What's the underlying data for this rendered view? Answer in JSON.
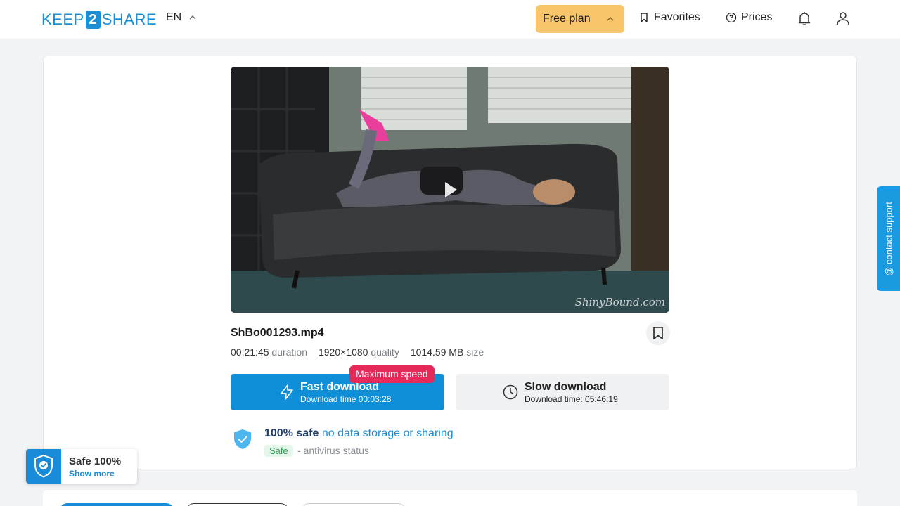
{
  "header": {
    "logo_left": "KEEP",
    "logo_mid": "2",
    "logo_right": "SHARE",
    "language": "EN",
    "plan_label": "Free plan",
    "favorites_label": "Favorites",
    "prices_label": "Prices"
  },
  "file": {
    "name": "ShBo001293.mp4",
    "duration_value": "00:21:45",
    "duration_label": "duration",
    "quality_value": "1920×1080",
    "quality_label": "quality",
    "size_value": "1014.59 MB",
    "size_label": "size",
    "watermark": "ShinyBound.com"
  },
  "download": {
    "fast_label": "Fast download",
    "fast_time": "Download time 00:03:28",
    "max_speed_badge": "Maximum speed",
    "slow_label": "Slow download",
    "slow_time": "Download time: 05:46:19"
  },
  "safety": {
    "title_strong": "100% safe",
    "title_rest": "no data storage or sharing",
    "tag": "Safe",
    "status": "- antivirus status"
  },
  "contact_support": "@ contact support",
  "safe_widget": {
    "title": "Safe 100%",
    "link": "Show more"
  },
  "colors": {
    "brand_blue": "#1b8fd6",
    "plan_yellow": "#f8c56a",
    "max_speed_red": "#e52a5a",
    "safe_green": "#2f9a55"
  }
}
